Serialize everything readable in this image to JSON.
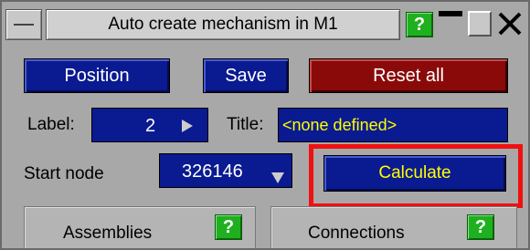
{
  "window": {
    "title": "Auto create mechanism in M1",
    "help_label": "?"
  },
  "toolbar": {
    "position_label": "Position",
    "save_label": "Save",
    "reset_label": "Reset all"
  },
  "label_row": {
    "label_caption": "Label:",
    "label_value": "2",
    "title_caption": "Title:",
    "title_value": "<none defined>"
  },
  "start_row": {
    "caption": "Start node",
    "value": "326146",
    "calculate_label": "Calculate"
  },
  "panels": {
    "assemblies_label": "Assemblies",
    "connections_label": "Connections",
    "help_label": "?"
  },
  "colors": {
    "button_blue": "#0a1a90",
    "button_red": "#8a0a0a",
    "title_value_yellow": "#ffff00",
    "highlight_red": "#f01010",
    "help_green": "#1fb01f"
  }
}
